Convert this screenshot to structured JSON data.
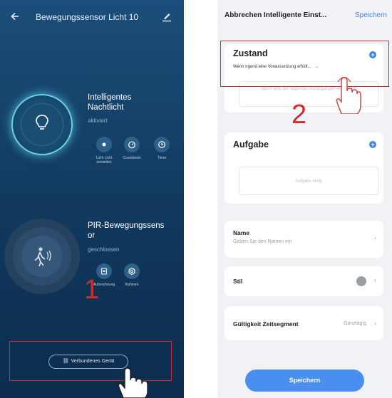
{
  "left": {
    "header_title": "Bewegungssensor Licht 10",
    "light_device": {
      "title_line1": "Intelligentes",
      "title_line2": "Nachtlicht",
      "status": "aktiviert",
      "actions": [
        {
          "label_l1": "Licht Licht",
          "label_l2": "einstellen",
          "icon": "light-dot-icon"
        },
        {
          "label_l1": "Countdown",
          "label_l2": "",
          "icon": "countdown-icon"
        },
        {
          "label_l1": "Timer",
          "label_l2": "",
          "icon": "timer-icon"
        }
      ]
    },
    "pir_device": {
      "title_line1": "PIR-Bewegungssens",
      "title_line2": "or",
      "status": "geschlossen",
      "actions": [
        {
          "label": "Aufzeichnung",
          "icon": "record-icon"
        },
        {
          "label": "Rahmen",
          "icon": "settings-icon"
        }
      ]
    },
    "connected_button": "Verbundenes Gerät",
    "step_number": "1"
  },
  "right": {
    "header": {
      "cancel_title": "Abbrechen Intelligente Einst...",
      "save": "Speichern"
    },
    "condition": {
      "title": "Zustand",
      "subtitle": "Wenn irgend eine Voraussetzung erfüllt...",
      "placeholder": "Wenn eine der folgenden Bedingungen erfüllt wird"
    },
    "step_number": "2",
    "task": {
      "title": "Aufgabe",
      "placeholder": "Aufgabe hinfg"
    },
    "name_row": {
      "title": "Name",
      "subtitle": "Geben Sie den Namen ein"
    },
    "style_row": {
      "title": "Stil"
    },
    "validity_row": {
      "title": "Gültigkeit Zeitsegment",
      "value": "Ganztägig"
    },
    "bottom_save": "Speichern"
  },
  "colors": {
    "accent_blue": "#3c86e8",
    "highlight_red": "#d42a2a",
    "left_bg": "#143f66"
  }
}
